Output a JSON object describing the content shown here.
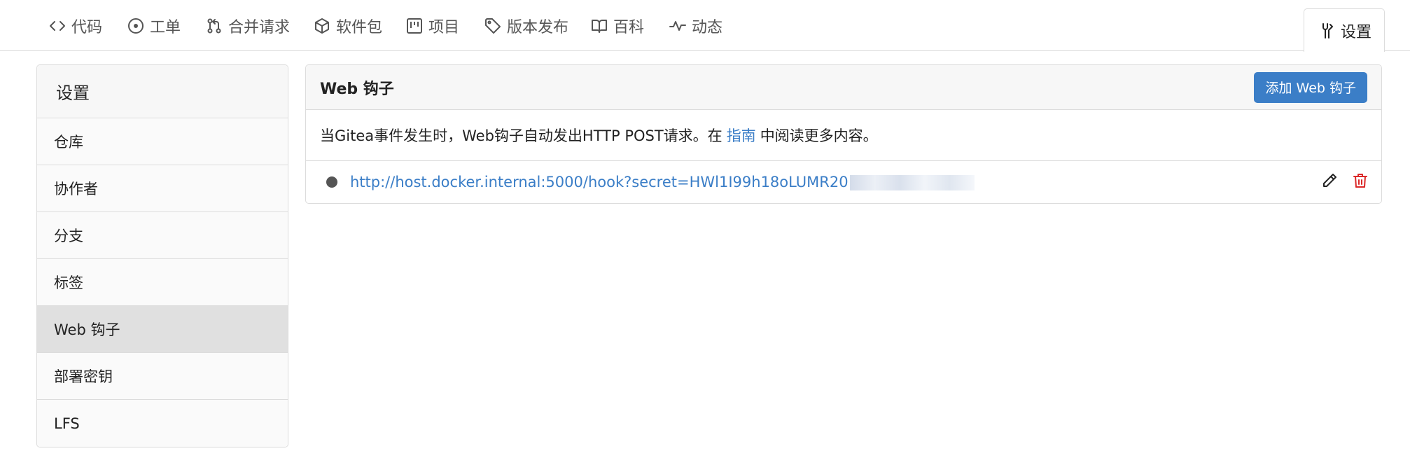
{
  "tabs": [
    {
      "label": "代码",
      "icon": "code-icon"
    },
    {
      "label": "工单",
      "icon": "issue-icon"
    },
    {
      "label": "合并请求",
      "icon": "pull-request-icon"
    },
    {
      "label": "软件包",
      "icon": "package-icon"
    },
    {
      "label": "项目",
      "icon": "project-icon"
    },
    {
      "label": "版本发布",
      "icon": "tag-icon"
    },
    {
      "label": "百科",
      "icon": "book-icon"
    },
    {
      "label": "动态",
      "icon": "pulse-icon"
    }
  ],
  "settings_tab": {
    "label": "设置",
    "icon": "tools-icon"
  },
  "sidebar": {
    "title": "设置",
    "items": [
      {
        "label": "仓库"
      },
      {
        "label": "协作者"
      },
      {
        "label": "分支"
      },
      {
        "label": "标签"
      },
      {
        "label": "Web 钩子",
        "active": true
      },
      {
        "label": "部署密钥"
      },
      {
        "label": "LFS"
      }
    ]
  },
  "webhooks": {
    "title": "Web 钩子",
    "add_button": "添加 Web 钩子",
    "description_prefix": "当Gitea事件发生时，Web钩子自动发出HTTP POST请求。在",
    "guide_link": "指南",
    "description_suffix": "中阅读更多内容。",
    "hooks": [
      {
        "url": "http://host.docker.internal:5000/hook?secret=HWl1I99h18oLUMR20",
        "status_color": "#555555"
      }
    ]
  },
  "colors": {
    "accent": "#3b7ec7",
    "danger": "#db2828",
    "active_item": "#e0e0e0"
  }
}
